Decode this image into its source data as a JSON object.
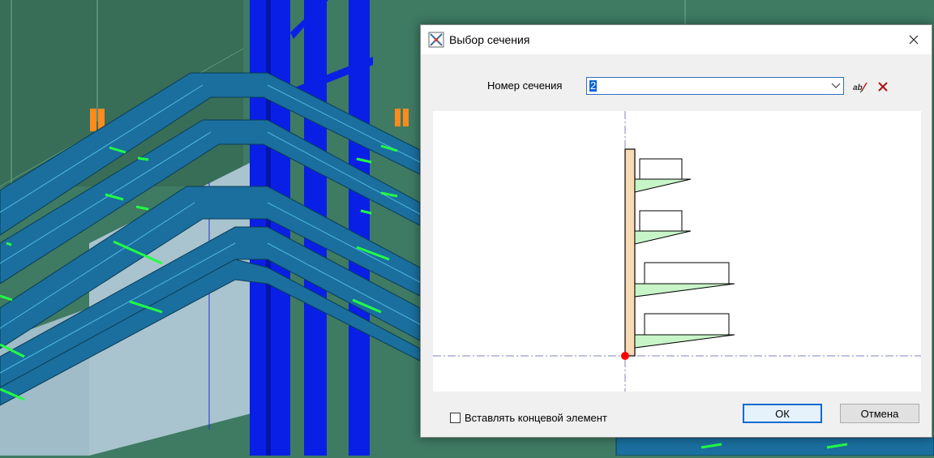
{
  "dialog": {
    "title": "Выбор сечения",
    "section_label": "Номер сечения",
    "section_value": "2",
    "insert_end_label": "Вставлять концевой элемент",
    "insert_end_checked": false,
    "ok_label": "ОК",
    "cancel_label": "Отмена"
  },
  "icons": {
    "app": "app-icon",
    "close": "close-icon",
    "combo": "chevron-down-icon",
    "rename": "rename-icon",
    "delete": "delete-icon"
  },
  "colors": {
    "scene_background": "#3f7a63",
    "tray_blue": "#1a6f9e",
    "column_blue": "#0a1fe6",
    "accent_green": "#22ff44",
    "support_orange": "#ff8a1e",
    "post_fill": "#f8dbb5",
    "shelf_fill": "#c8f5c8",
    "origin_dot": "#ff0000",
    "selection_blue": "#0a64d6"
  }
}
